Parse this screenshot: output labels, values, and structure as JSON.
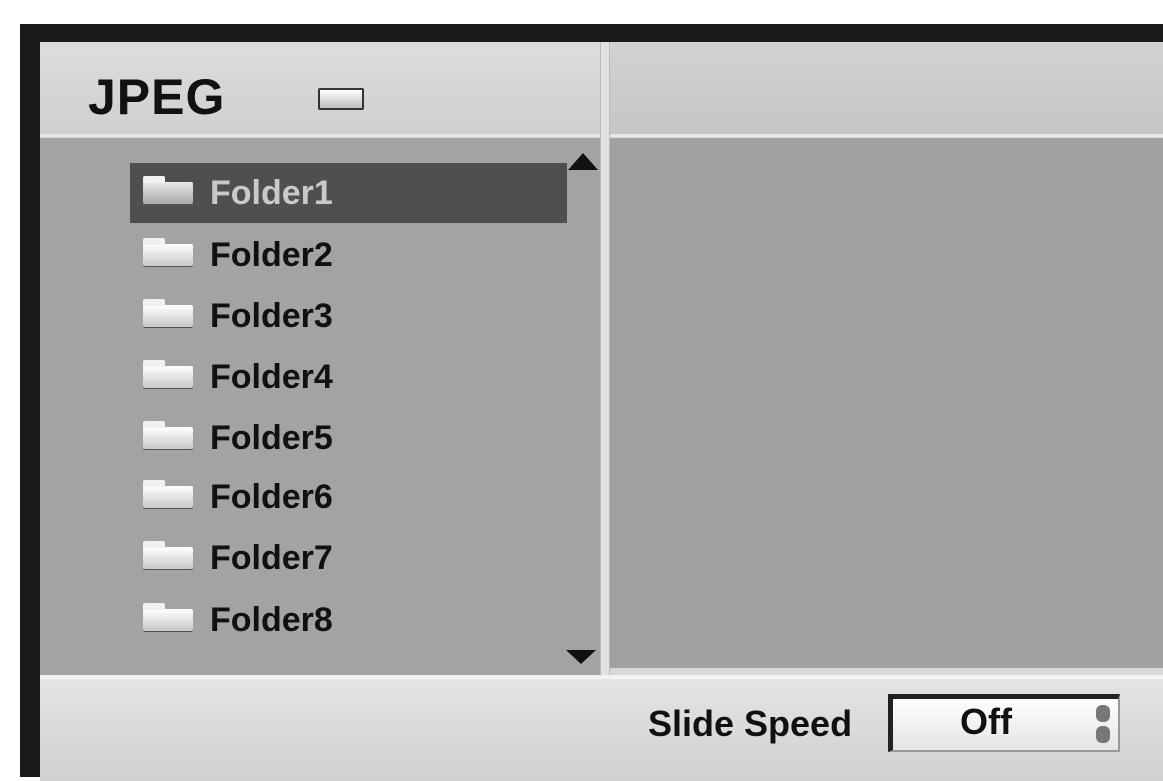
{
  "header": {
    "title": "JPEG"
  },
  "folders": [
    {
      "label": "Folder1",
      "selected": true
    },
    {
      "label": "Folder2",
      "selected": false
    },
    {
      "label": "Folder3",
      "selected": false
    },
    {
      "label": "Folder4",
      "selected": false
    },
    {
      "label": "Folder5",
      "selected": false
    },
    {
      "label": "Folder6",
      "selected": false
    },
    {
      "label": "Folder7",
      "selected": false
    },
    {
      "label": "Folder8",
      "selected": false
    }
  ],
  "footer": {
    "slide_speed_label": "Slide Speed",
    "slide_speed_value": "Off"
  },
  "icons": {
    "title": "drive-icon",
    "folder": "folder-icon",
    "scroll_up": "scroll-up-icon",
    "scroll_down": "scroll-down-icon",
    "spinner": "spinner-icon"
  },
  "colors": {
    "selection": "#4f4f4f",
    "pane": "#a3a3a3",
    "header": "#d8d8d8"
  }
}
